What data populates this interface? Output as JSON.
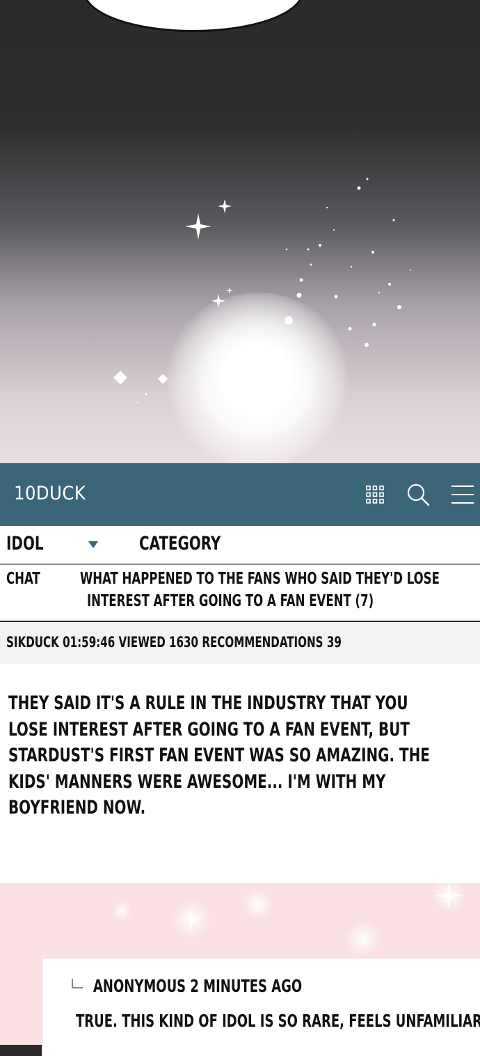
{
  "app": {
    "name": "10DUCK",
    "icons": [
      "grid-icon",
      "search-icon",
      "menu-icon"
    ],
    "accent_color": "#3b6679"
  },
  "board": {
    "name": "IDOL",
    "category_label": "CATEGORY"
  },
  "post": {
    "tag": "CHAT",
    "title_line1": "WHAT HAPPENED TO THE FANS WHO SAID THEY'D LOSE",
    "title_line2": "INTEREST AFTER GOING TO A FAN EVENT (7)",
    "meta": "SIKDUCK 01:59:46 VIEWED 1630 RECOMMENDATIONS 39",
    "body_lines": [
      "THEY SAID IT'S A RULE IN THE INDUSTRY THAT YOU",
      "LOSE INTEREST AFTER GOING TO A FAN EVENT, BUT",
      "STARDUST'S FIRST FAN EVENT WAS SO AMAZING. THE",
      "KIDS' MANNERS WERE AWESOME... I'M WITH MY",
      "BOYFRIEND NOW."
    ]
  },
  "comment": {
    "author_time": "ANONYMOUS 2 MINUTES AGO",
    "text": "TRUE. THIS KIND OF IDOL IS SO RARE, FEELS UNFAMILIAR;;"
  }
}
